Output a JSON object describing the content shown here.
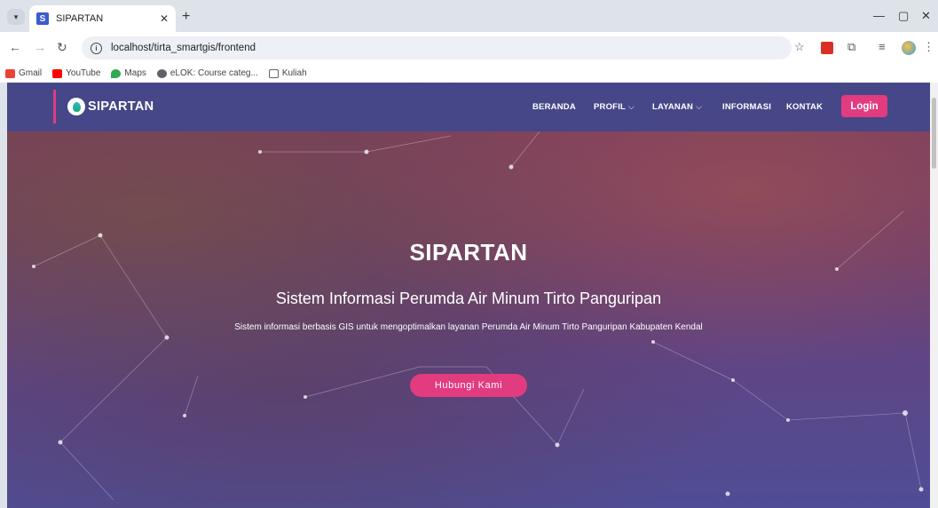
{
  "browser": {
    "tab_title": "SIPARTAN",
    "tab_favicon": "S",
    "url": "localhost/tirta_smartgis/frontend",
    "bookmarks": [
      {
        "label": "Gmail",
        "color": "#ea4335"
      },
      {
        "label": "YouTube",
        "color": "#ff0000"
      },
      {
        "label": "Maps",
        "color": "#34a853"
      },
      {
        "label": "eLOK: Course categ...",
        "color": "#5f6368"
      },
      {
        "label": "Kuliah",
        "color": "#5f6368"
      }
    ]
  },
  "site": {
    "brand": "SIPARTAN",
    "nav": {
      "beranda": "BERANDA",
      "profil": "PROFIL",
      "layanan": "LAYANAN",
      "informasi": "INFORMASI",
      "kontak": "KONTAK",
      "login": "Login"
    },
    "hero": {
      "title": "SIPARTAN",
      "subtitle": "Sistem Informasi Perumda Air Minum Tirto Panguripan",
      "description": "Sistem informasi berbasis GIS untuk mengoptimalkan layanan Perumda Air Minum Tirto Panguripan Kabupaten Kendal",
      "button": "Hubungi Kami"
    }
  },
  "colors": {
    "accent": "#e23b7f",
    "navbar": "#41488c"
  }
}
